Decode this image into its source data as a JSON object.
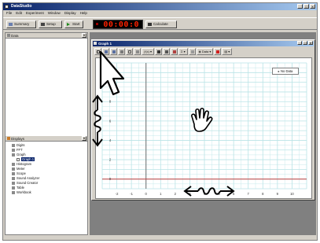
{
  "app": {
    "title": "DataStudio"
  },
  "menu": [
    "File",
    "Edit",
    "Experiment",
    "Window",
    "Display",
    "Help"
  ],
  "toolbar": {
    "summary": "Summary",
    "setup": "Setup",
    "start": "Start",
    "timer": "00:00:0",
    "calculate": "Calculate"
  },
  "left_panel": {
    "data_header": "Data",
    "displays_header": "Displays",
    "tree": [
      {
        "label": "Digits",
        "level": 1,
        "icon": "digits-icon"
      },
      {
        "label": "FFT",
        "level": 1,
        "icon": "fft-icon"
      },
      {
        "label": "Graph",
        "level": 1,
        "icon": "graph-icon"
      },
      {
        "label": "Graph 1",
        "level": 2,
        "icon": "graph-doc-icon",
        "selected": true
      },
      {
        "label": "Histogram",
        "level": 1,
        "icon": "histogram-icon"
      },
      {
        "label": "Meter",
        "level": 1,
        "icon": "meter-icon"
      },
      {
        "label": "Scope",
        "level": 1,
        "icon": "scope-icon"
      },
      {
        "label": "Sound Analyzer",
        "level": 1,
        "icon": "sound-analyzer-icon"
      },
      {
        "label": "Sound Creator",
        "level": 1,
        "icon": "sound-creator-icon"
      },
      {
        "label": "Table",
        "level": 1,
        "icon": "table-icon"
      },
      {
        "label": "Workbook",
        "level": 1,
        "icon": "workbook-icon"
      }
    ]
  },
  "graph_window": {
    "title": "Graph 1",
    "toolbar": {
      "data_button": "Data",
      "legend": "No Data"
    }
  },
  "colors": {
    "titlebar": "#0a246a",
    "chrome": "#d4d0c8",
    "workspace": "#808080",
    "timer_text": "#ff2200",
    "grid": "#b9e3e6",
    "axis": "#c04040"
  },
  "chart_data": {
    "type": "line",
    "title": "",
    "xlabel": "",
    "ylabel": "",
    "xlim": [
      -3,
      11
    ],
    "ylim": [
      -1,
      12
    ],
    "x_ticks": [
      "-2",
      "-1",
      "0",
      "1",
      "2",
      "3",
      "4",
      "5",
      "6",
      "7",
      "8",
      "9",
      "10"
    ],
    "y_ticks": [
      "0",
      "2",
      "4",
      "6",
      "8",
      "10"
    ],
    "grid": true,
    "series": [],
    "legend": "No Data",
    "legend_position": "top-right"
  },
  "overlay_icons": [
    "pointer-arrow-icon",
    "scroll-vertical-icon",
    "grab-hand-icon",
    "scroll-horizontal-icon"
  ]
}
